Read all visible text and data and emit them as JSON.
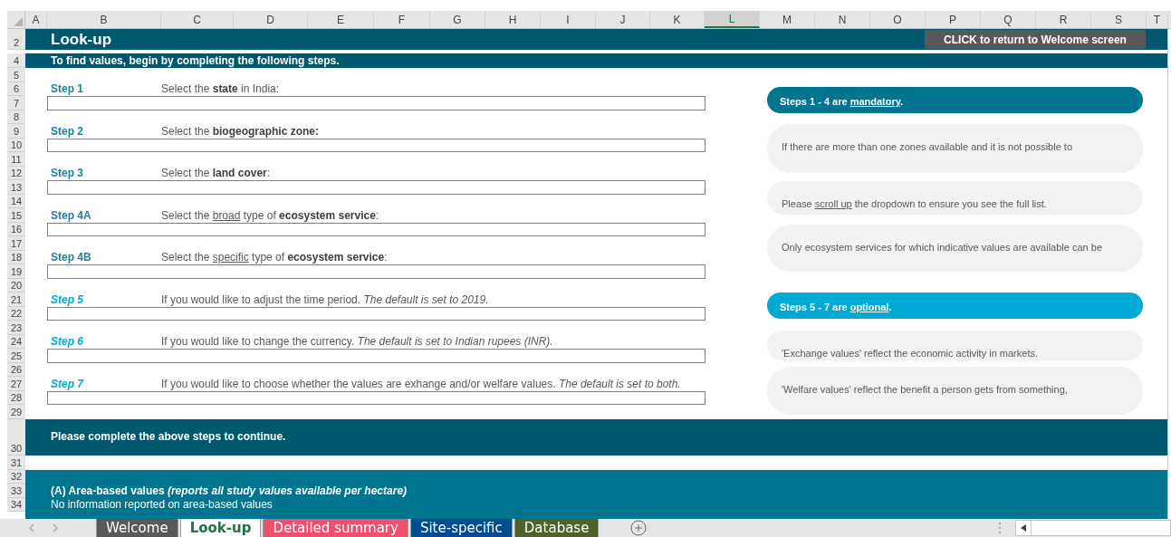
{
  "columns": [
    {
      "label": "A",
      "selected": false
    },
    {
      "label": "B",
      "selected": false
    },
    {
      "label": "C",
      "selected": false
    },
    {
      "label": "D",
      "selected": false
    },
    {
      "label": "E",
      "selected": false
    },
    {
      "label": "F",
      "selected": false
    },
    {
      "label": "G",
      "selected": false
    },
    {
      "label": "H",
      "selected": false
    },
    {
      "label": "I",
      "selected": false
    },
    {
      "label": "J",
      "selected": false
    },
    {
      "label": "K",
      "selected": false
    },
    {
      "label": "L",
      "selected": true
    },
    {
      "label": "M",
      "selected": false
    },
    {
      "label": "N",
      "selected": false
    },
    {
      "label": "O",
      "selected": false
    },
    {
      "label": "P",
      "selected": false
    },
    {
      "label": "Q",
      "selected": false
    },
    {
      "label": "R",
      "selected": false
    },
    {
      "label": "S",
      "selected": false
    },
    {
      "label": "T",
      "selected": false
    }
  ],
  "rows": [
    "2",
    "4",
    "5",
    "6",
    "7",
    "8",
    "9",
    "10",
    "11",
    "12",
    "13",
    "14",
    "15",
    "16",
    "17",
    "18",
    "19",
    "20",
    "21",
    "22",
    "23",
    "24",
    "25",
    "26",
    "27",
    "28",
    "29",
    "30",
    "31",
    "32",
    "33",
    "34"
  ],
  "title": "Look-up",
  "welcome_button": "CLICK to return to Welcome screen",
  "intro": "To find values, begin by completing the following steps.",
  "steps": [
    {
      "label": "Step 1",
      "optional": false,
      "description": [
        {
          "text": "Select the **state** in India:",
          "underlined": false
        }
      ]
    },
    {
      "label": "Step 2",
      "optional": false,
      "description": [
        {
          "text": "Select the **biogeographic zone:**",
          "underlined": false
        }
      ]
    },
    {
      "label": "Step 3",
      "optional": false,
      "description": [
        {
          "text": "Select the **land cover**:",
          "underlined": false
        }
      ]
    },
    {
      "label": "Step 4A",
      "optional": false,
      "description": [
        {
          "text": "Select the ",
          "underlined": false
        },
        {
          "text": "broad",
          "underlined": true
        },
        {
          "text": " type of **ecosystem service**:",
          "underlined": false
        }
      ]
    },
    {
      "label": "Step 4B",
      "optional": false,
      "description": [
        {
          "text": "Select the ",
          "underlined": false
        },
        {
          "text": "specific",
          "underlined": true
        },
        {
          "text": " type of **ecosystem service**:",
          "underlined": false
        }
      ]
    },
    {
      "label": "Step 5",
      "optional": true,
      "description": [
        {
          "text": "If you would like to adjust the time period. *The default is set to 2019.*",
          "underlined": false
        }
      ]
    },
    {
      "label": "Step 6",
      "optional": true,
      "description": [
        {
          "text": "If you would like to change the currency. *The default is set to Indian rupees (INR).*",
          "underlined": false
        }
      ]
    },
    {
      "label": "Step 7",
      "optional": true,
      "description": [
        {
          "text": "If you would like to choose whether the values are exhange and/or welfare values. *The default is set to both.*",
          "underlined": false
        }
      ]
    }
  ],
  "notes": [
    {
      "kind": "header",
      "color": "#00758f",
      "segments": [
        {
          "text": "Steps 1 - 4 are ",
          "underlined": false
        },
        {
          "text": "mandatory",
          "underlined": true
        },
        {
          "text": ".",
          "underlined": false
        }
      ]
    },
    {
      "kind": "note",
      "segments": [
        {
          "text": "If there are more than one zones available and it is not possible to",
          "underlined": false
        }
      ]
    },
    {
      "kind": "note",
      "segments": [
        {
          "text": "Please ",
          "underlined": false
        },
        {
          "text": "scroll up",
          "underlined": true
        },
        {
          "text": " the dropdown to ensure you see the full list.",
          "underlined": false
        }
      ]
    },
    {
      "kind": "note",
      "segments": [
        {
          "text": "Only ecosystem services for which indicative values are available can be",
          "underlined": false
        }
      ]
    },
    {
      "kind": "header",
      "color": "#00aad4",
      "segments": [
        {
          "text": "Steps 5 - 7 are ",
          "underlined": false
        },
        {
          "text": "optional",
          "underlined": true
        },
        {
          "text": ".",
          "underlined": false
        }
      ]
    },
    {
      "kind": "note",
      "segments": [
        {
          "text": "'Exchange values' reflect the economic activity in markets.",
          "underlined": false
        }
      ]
    },
    {
      "kind": "note",
      "segments": [
        {
          "text": "'Welfare values' reflect the benefit a person gets from something,",
          "underlined": false
        }
      ]
    }
  ],
  "continue_message": "Please complete the above steps to continue.",
  "area_section": {
    "heading": "(A) Area-based values ",
    "heading_note": "(reports all study values available per hectare)",
    "message": "No information reported on area-based values"
  },
  "sheet_tabs": [
    {
      "label": "Welcome",
      "color": "#595959",
      "selected": false
    },
    {
      "label": "Look-up",
      "color": "#ffffff",
      "selected": true
    },
    {
      "label": "Detailed summary",
      "color": "#f0506e",
      "selected": false
    },
    {
      "label": "Site-specific",
      "color": "#004b8d",
      "selected": false
    },
    {
      "label": "Database",
      "color": "#4f6228",
      "selected": false
    }
  ]
}
